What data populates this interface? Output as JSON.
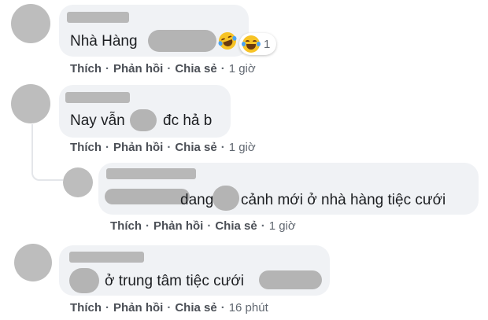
{
  "comments": [
    {
      "text": "Nhà Hàng",
      "reaction_count": "1",
      "reaction_icon": "laugh-emoji-icon",
      "actions": {
        "like": "Thích",
        "reply": "Phản hồi",
        "share": "Chia sẻ",
        "time": "1 giờ"
      }
    },
    {
      "text_before": "Nay vẫn",
      "text_after": "đc hả b",
      "actions": {
        "like": "Thích",
        "reply": "Phản hồi",
        "share": "Chia sẻ",
        "time": "1 giờ"
      }
    },
    {
      "text_middle": "dang",
      "text_after": "cảnh mới ở nhà hàng tiệc cưới",
      "actions": {
        "like": "Thích",
        "reply": "Phản hồi",
        "share": "Chia sẻ",
        "time": "1 giờ"
      }
    },
    {
      "text": "ở trung tâm tiệc cưới",
      "actions": {
        "like": "Thích",
        "reply": "Phản hồi",
        "share": "Chia sẻ",
        "time": "16 phút"
      }
    }
  ],
  "separator": "·",
  "colors": {
    "bubble": "#f0f2f5",
    "text": "#1c1e21",
    "meta": "#606770",
    "avatar": "#bdbdbd",
    "emoji": "#f7c325"
  }
}
